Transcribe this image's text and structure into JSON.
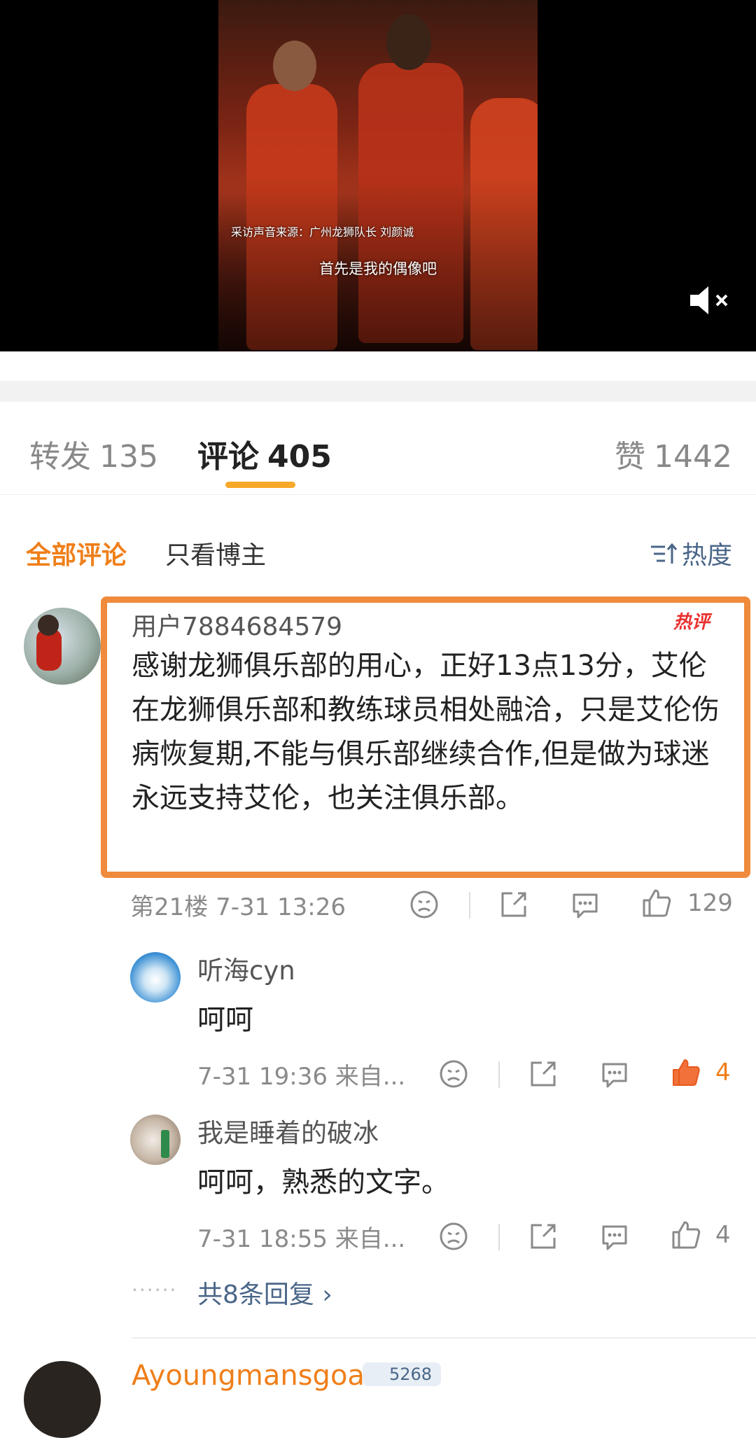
{
  "video": {
    "source_caption": "采访声音来源：广州龙狮队长  刘颜诚",
    "subtitle": "首先是我的偶像吧",
    "mute_icon": "volume-muted-icon"
  },
  "tabs": [
    {
      "label": "转发",
      "count": "135"
    },
    {
      "label": "评论",
      "count": "405"
    },
    {
      "label": "赞",
      "count": "1442"
    }
  ],
  "filter": {
    "all": "全部评论",
    "op_only": "只看博主",
    "sort": "热度"
  },
  "comment": {
    "username": "用户7884684579",
    "badge": "热评",
    "text": "感谢龙狮俱乐部的用心，正好13点13分，艾伦在龙狮俱乐部和教练球员相处融洽，只是艾伦伤病恢复期,不能与俱乐部继续合作,但是做为球迷永远支持艾伦，也关注俱乐部。",
    "floor_time": "第21楼 7-31 13:26",
    "likes": "129",
    "highlight_color": "#f08a3c"
  },
  "replies": [
    {
      "username": "听海cyn",
      "text": "呵呵",
      "time": "7-31 19:36 来自...",
      "likes": "4",
      "liked": true
    },
    {
      "username": "我是睡着的破冰",
      "text": "呵呵，熟悉的文字。",
      "time": "7-31 18:55 来自...",
      "likes": "4",
      "liked": false
    }
  ],
  "more_replies": "共8条回复 ›",
  "more_dots": "······",
  "next_comment": {
    "username": "Ayoungmansgoal",
    "badge": "5268"
  },
  "colors": {
    "accent": "#ef7f1a",
    "tab_underline": "#f7a828",
    "link": "#4a6688"
  }
}
